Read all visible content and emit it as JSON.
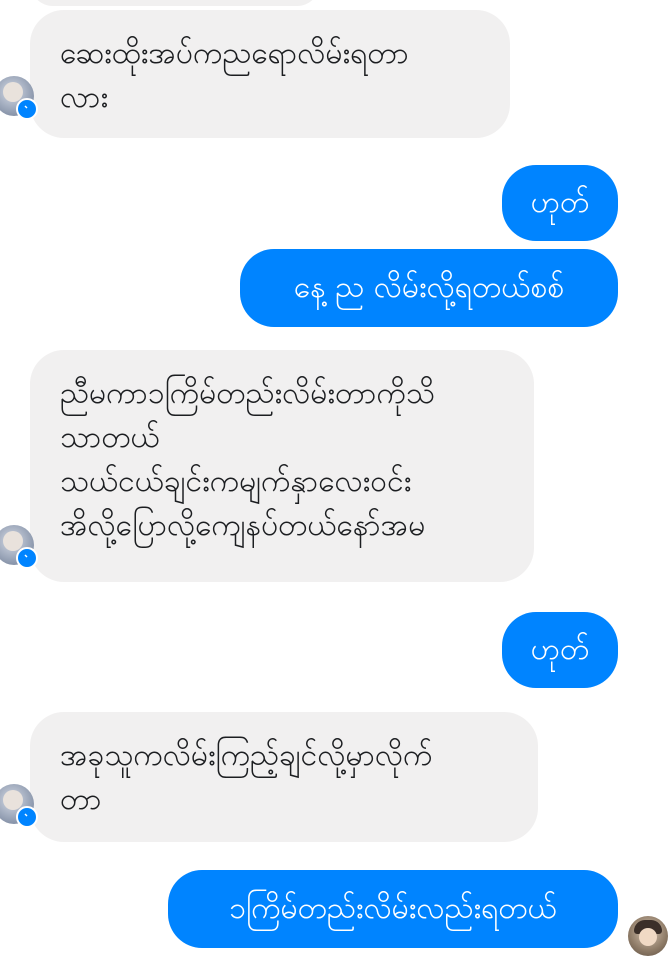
{
  "conversation": {
    "messages": [
      {
        "direction": "incoming",
        "text": "ဆေးထိုးအပ်ကညရောလိမ်းရတာ\nလား"
      },
      {
        "direction": "outgoing",
        "text": "ဟုတ်"
      },
      {
        "direction": "outgoing",
        "text": "နေ့ ည လိမ်းလို့ရတယ်စစ်"
      },
      {
        "direction": "incoming",
        "text": "ညီမကာ၁ကြိမ်တည်းလိမ်းတာကိုသိ\nသာတယ်\nသယ်ငယ်ချင်းကမျက်နှာလေးဝင်း\nအိလို့ပြောလို့ကျေနပ်တယ်နော်အမ"
      },
      {
        "direction": "outgoing",
        "text": "ဟုတ်"
      },
      {
        "direction": "incoming",
        "text": "အခုသူကလိမ်းကြည့်ချင်လို့မှာလိုက်\nတာ"
      },
      {
        "direction": "outgoing",
        "text": "၁ကြိမ်တည်းလိမ်းလည်းရတယ်"
      }
    ]
  },
  "colors": {
    "incoming_bubble": "#f1f0f0",
    "outgoing_bubble": "#0084ff",
    "messenger_badge": "#0084ff"
  },
  "icons": {
    "contact_avatar": "user-avatar-icon",
    "messenger_badge": "messenger-icon",
    "read_receipt": "read-receipt-avatar-icon"
  }
}
